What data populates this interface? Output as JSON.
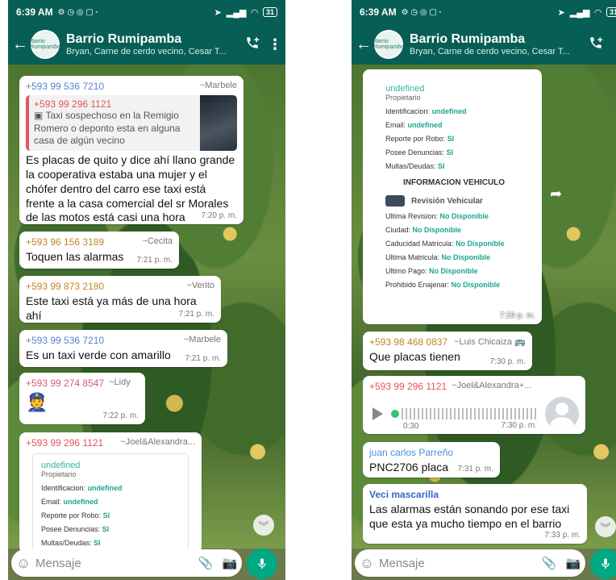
{
  "status_bar": {
    "time": "6:39 AM",
    "battery": "31"
  },
  "chat": {
    "title": "Barrio Rumipamba",
    "subtitle": "Bryan, Carne de cerdo vecino, Cesar T...",
    "avatar_text": "Barrio Rumipamba"
  },
  "input": {
    "placeholder": "Mensaje"
  },
  "left": {
    "messages": [
      {
        "number": "+593 99 536 7210",
        "alias": "~Marbele",
        "quote_number": "+593 99 296 1121",
        "quote_text": "Taxi sospechoso en la Remigio Romero o deponto esta en alguna casa de algún vecino",
        "text": "Es placas de quito y dice ahí llano grande la cooperativa estaba una mujer y el chófer dentro del carro ese taxi está frente a la casa comercial del sr Morales de las motos está casi una hora",
        "time": "7:20 p. m."
      },
      {
        "number": "+593 96 156 3189",
        "alias": "~Cecita",
        "text": "Toquen las alarmas",
        "time": "7:21 p. m."
      },
      {
        "number": "+593 99 873 2180",
        "alias": "~Verito",
        "text": "Este taxi está ya más de una hora ahí",
        "time": "7:21 p. m."
      },
      {
        "number": "+593 99 536 7210",
        "alias": "~Marbele",
        "text": "Es un  taxi verde con amarillo",
        "time": "7:21 p. m."
      },
      {
        "number": "+593 99 274 8547",
        "alias": "~Lidy",
        "text": "👮",
        "time": "7:22 p. m."
      },
      {
        "number": "+593 99 296 1121",
        "alias": "~Joel&Alexandra..."
      }
    ],
    "card": {
      "name": "undefined",
      "role": "Propietario",
      "rows": [
        {
          "label": "Identificacion:",
          "value": "undefined"
        },
        {
          "label": "Email:",
          "value": "undefined"
        },
        {
          "label": "Reporte por Robo:",
          "value": "SI"
        },
        {
          "label": "Posee Denuncias:",
          "value": "SI"
        },
        {
          "label": "Multas/Deudas:",
          "value": "SI"
        }
      ]
    }
  },
  "right": {
    "card": {
      "name": "undefined",
      "role": "Propietario",
      "rows": [
        {
          "label": "Identificacion:",
          "value": "undefined"
        },
        {
          "label": "Email:",
          "value": "undefined"
        },
        {
          "label": "Reporte por Robo:",
          "value": "SI"
        },
        {
          "label": "Posee Denuncias:",
          "value": "SI"
        },
        {
          "label": "Multas/Deudas:",
          "value": "SI"
        }
      ],
      "vehicle_header": "INFORMACION VEHICULO",
      "vehicle_sub": "Revisión Vehicular",
      "vehicle_rows": [
        {
          "label": "Ultima Revision:",
          "value": "No Disponible"
        },
        {
          "label": "Ciudad:",
          "value": "No Disponible"
        },
        {
          "label": "Caducidad Matricula:",
          "value": "No Disponible"
        },
        {
          "label": "Ultima Matricula:",
          "value": "No Disponible"
        },
        {
          "label": "Ultimo Pago:",
          "value": "No Disponible"
        },
        {
          "label": "Prohibido Enajenar:",
          "value": "No Disponible"
        }
      ],
      "time": "7:29 p. m."
    },
    "messages": [
      {
        "number": "+593 98 468 0837",
        "alias": "~Luis Chicaiza 🚌",
        "text": "Que placas tienen",
        "time": "7:30 p. m."
      },
      {
        "number": "+593 99 296 1121",
        "alias": "~Joel&Alexandra+...",
        "duration": "0:30",
        "time": "7:30 p. m."
      },
      {
        "name": "juan carlos Parreño",
        "text": "PNC2706 placa",
        "time": "7:31 p. m."
      },
      {
        "name": "Veci mascarilla",
        "text": "Las alarmas están sonando por ese taxi que esta ya mucho tiempo en el barrio",
        "time": "7:33 p. m."
      }
    ]
  },
  "colors": {
    "header": "#075e54",
    "accent": "#00a884",
    "bubble": "#ffffff"
  }
}
